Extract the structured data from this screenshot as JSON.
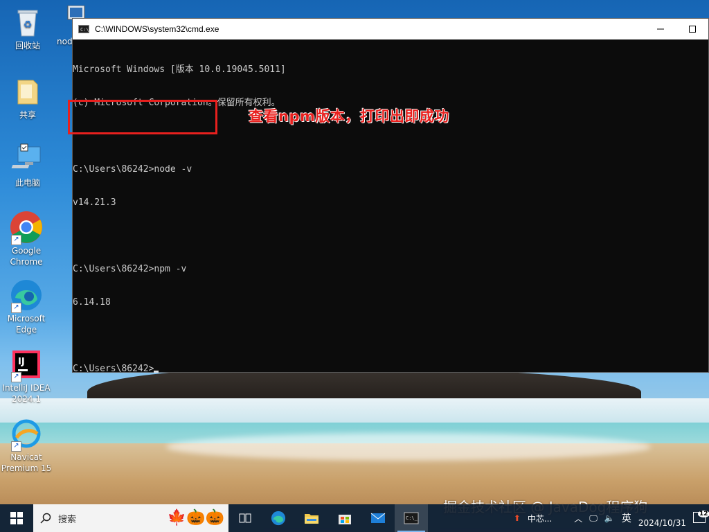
{
  "desktop": {
    "icons": [
      {
        "label": "回收站"
      },
      {
        "label": "nod"
      },
      {
        "label": "共享"
      },
      {
        "label": "此电脑"
      },
      {
        "label": "Google Chrome"
      },
      {
        "label": "Microsoft Edge"
      },
      {
        "label": "IntelliJ IDEA 2024.1"
      },
      {
        "label": "Navicat Premium 15"
      }
    ]
  },
  "cmd_window": {
    "title": "C:\\WINDOWS\\system32\\cmd.exe",
    "lines": [
      "Microsoft Windows [版本 10.0.19045.5011]",
      "(c) Microsoft Corporation。保留所有权利。",
      "",
      "C:\\Users\\86242>node -v",
      "v14.21.3",
      "",
      "C:\\Users\\86242>npm -v",
      "6.14.18",
      "",
      "C:\\Users\\86242>"
    ]
  },
  "annotation": {
    "text": "查看npm版本，打印出即成功",
    "color": "#e8201e"
  },
  "watermark": "掘金技术社区 @ JavaDog程序狗",
  "taskbar": {
    "search_placeholder": "搜索",
    "apps": [
      "task-view",
      "edge",
      "file-explorer",
      "store",
      "mail",
      "cmd"
    ],
    "tray": {
      "app_label": "中芯...",
      "ime": "英",
      "date": "2024/10/31",
      "notifications": "12"
    }
  }
}
